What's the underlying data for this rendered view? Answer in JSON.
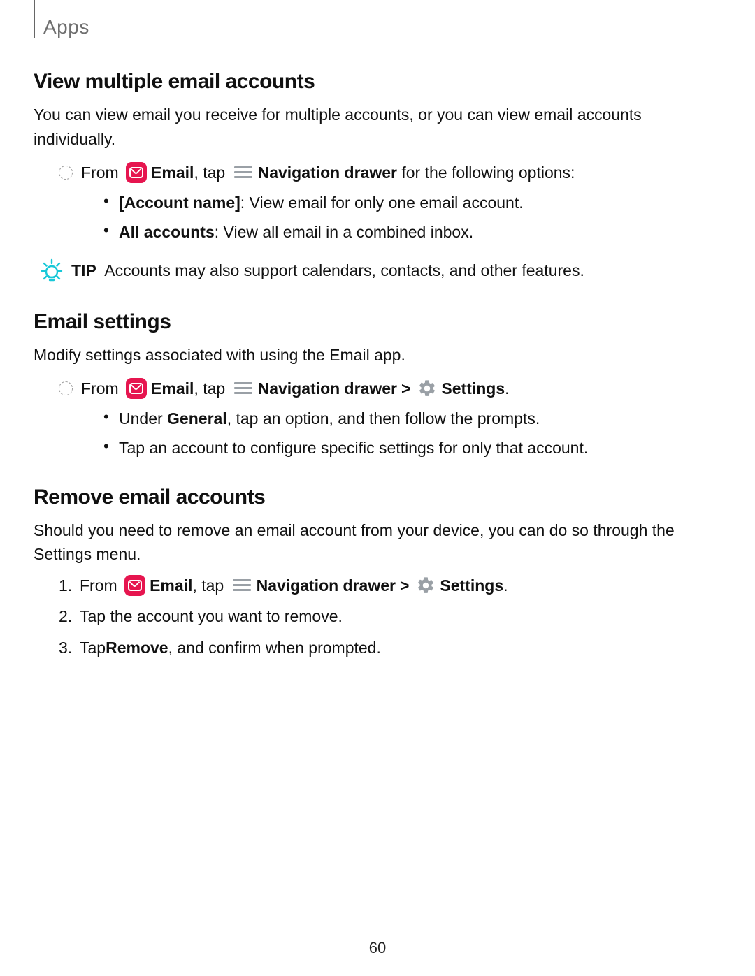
{
  "header": {
    "section": "Apps"
  },
  "page_number": "60",
  "s1": {
    "heading": "View multiple email accounts",
    "intro": "You can view email you receive for multiple accounts, or you can view email accounts individually.",
    "line": {
      "from": "From ",
      "email": "Email",
      "comma_tap": ", tap ",
      "navdrawer": "Navigation drawer",
      "tail": " for the following options:"
    },
    "bullets": [
      {
        "b": "[Account name]",
        "r": ": View email for only one email account."
      },
      {
        "b": "All accounts",
        "r": ": View all email in a combined inbox."
      }
    ],
    "tip": {
      "label": "TIP",
      "text": "  Accounts may also support calendars, contacts, and other features."
    }
  },
  "s2": {
    "heading": "Email settings",
    "intro": "Modify settings associated with using the Email app.",
    "line": {
      "from": "From ",
      "email": "Email",
      "comma_tap": ", tap ",
      "navdrawer": "Navigation drawer",
      "chev": ">",
      "settings": "Settings",
      "dot": "."
    },
    "bullets": [
      {
        "pre": "Under ",
        "b": "General",
        "r": ", tap an option, and then follow the prompts."
      },
      {
        "r": "Tap an account to configure specific settings for only that account."
      }
    ]
  },
  "s3": {
    "heading": "Remove email accounts",
    "intro": "Should you need to remove an email account from your device, you can do so through the Settings menu.",
    "steps": [
      {
        "n": "1.",
        "from": "From ",
        "email": "Email",
        "comma_tap": ", tap ",
        "navdrawer": "Navigation drawer",
        "chev": ">",
        "settings": "Settings",
        "dot": "."
      },
      {
        "n": "2.",
        "text": "Tap the account you want to remove."
      },
      {
        "n": "3.",
        "pre": "Tap ",
        "b": "Remove",
        "r": ", and confirm when prompted."
      }
    ]
  }
}
